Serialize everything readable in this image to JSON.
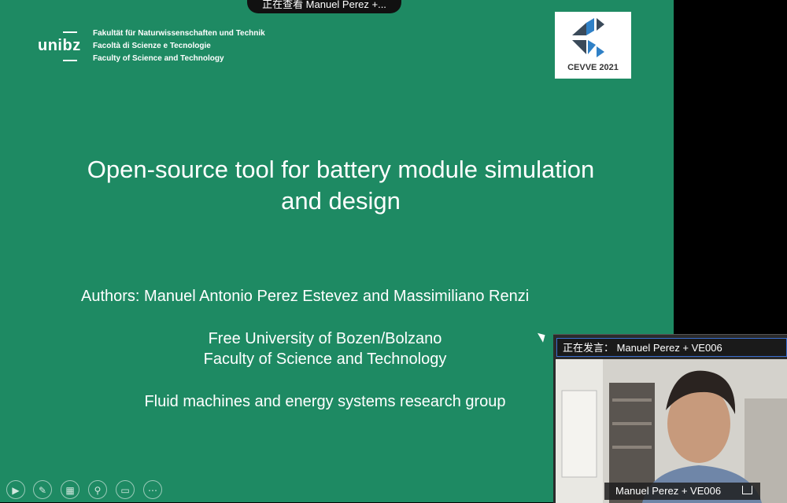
{
  "banner": {
    "text": "正在查看 Manuel Perez +..."
  },
  "slide": {
    "logo_text": "unibz",
    "faculty_lines": [
      "Fakultät für Naturwissenschaften und Technik",
      "Facoltà di Scienze e Tecnologie",
      "Faculty of Science and Technology"
    ],
    "conference_logo": "CEVVE 2021",
    "title_line1": "Open-source tool for battery module simulation",
    "title_line2": "and design",
    "authors": "Authors: Manuel Antonio Perez Estevez and Massimiliano Renzi",
    "univ_line1": "Free University of Bozen/Bolzano",
    "univ_line2": "Faculty of Science and Technology",
    "group": "Fluid machines and energy systems research group"
  },
  "toolbar": {
    "icons": [
      "play-icon",
      "pen-icon",
      "slides-icon",
      "zoom-icon",
      "subtitles-icon",
      "more-icon"
    ]
  },
  "video": {
    "speaking": "正在发言： Manuel Perez + VE006",
    "name": "Manuel Perez + VE006"
  },
  "colors": {
    "slide_bg": "#1e8a63",
    "accent_border": "#3a6fd0"
  }
}
